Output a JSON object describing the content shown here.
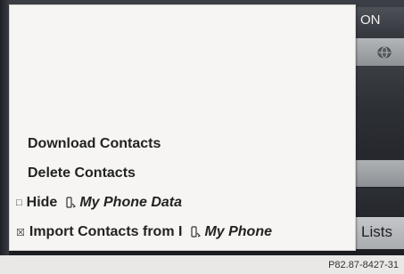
{
  "header": {
    "status_text": "ON"
  },
  "menu": {
    "items": [
      {
        "label": "Download Contacts"
      },
      {
        "label": "Delete Contacts"
      },
      {
        "label": "Hide",
        "checkbox": "□",
        "source": "My Phone Data"
      },
      {
        "label": "Import Contacts from I",
        "checkbox": "☒",
        "source": "My Phone"
      }
    ]
  },
  "side": {
    "lists_label": "Lists"
  },
  "caption": "P82.87-8427-31",
  "icons": {
    "phone": "phone-handset-icon",
    "nav": "globe-icon"
  }
}
